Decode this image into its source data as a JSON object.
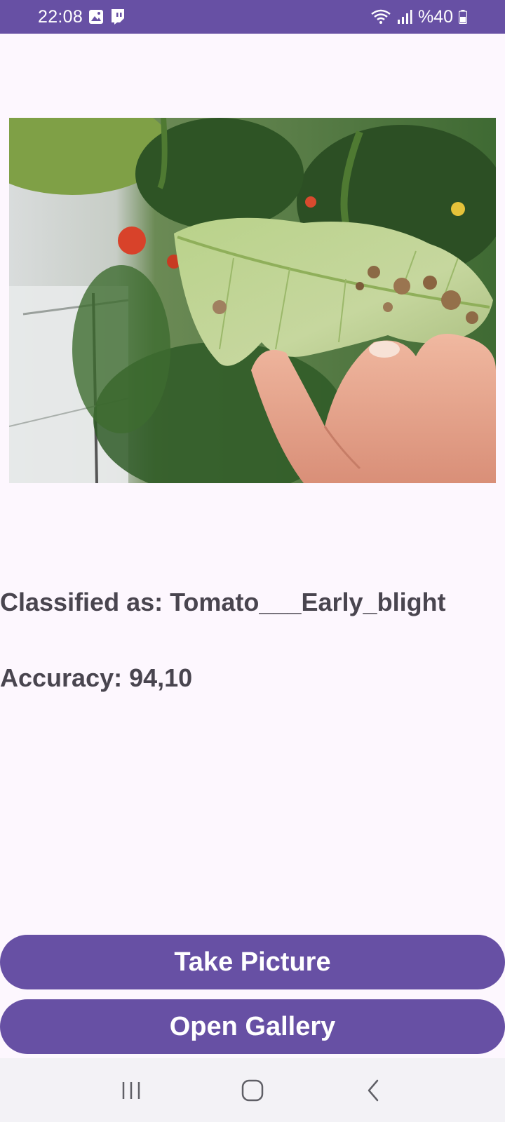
{
  "status_bar": {
    "time": "22:08",
    "battery": "%40",
    "icons": [
      "gallery-icon",
      "twitch-icon",
      "wifi-icon",
      "signal-icon",
      "battery-icon"
    ],
    "background": "#6750a4"
  },
  "main": {
    "image": {
      "description_icon": "tomato-leaf-photo"
    },
    "classified_text": "Classified as: Tomato___Early_blight",
    "accuracy_text": "Accuracy: 94,10"
  },
  "buttons": {
    "take_picture": "Take Picture",
    "open_gallery": "Open Gallery",
    "color": "#6750a4"
  },
  "nav_bar": {
    "icons": [
      "recent-apps-icon",
      "home-icon",
      "back-icon"
    ]
  }
}
